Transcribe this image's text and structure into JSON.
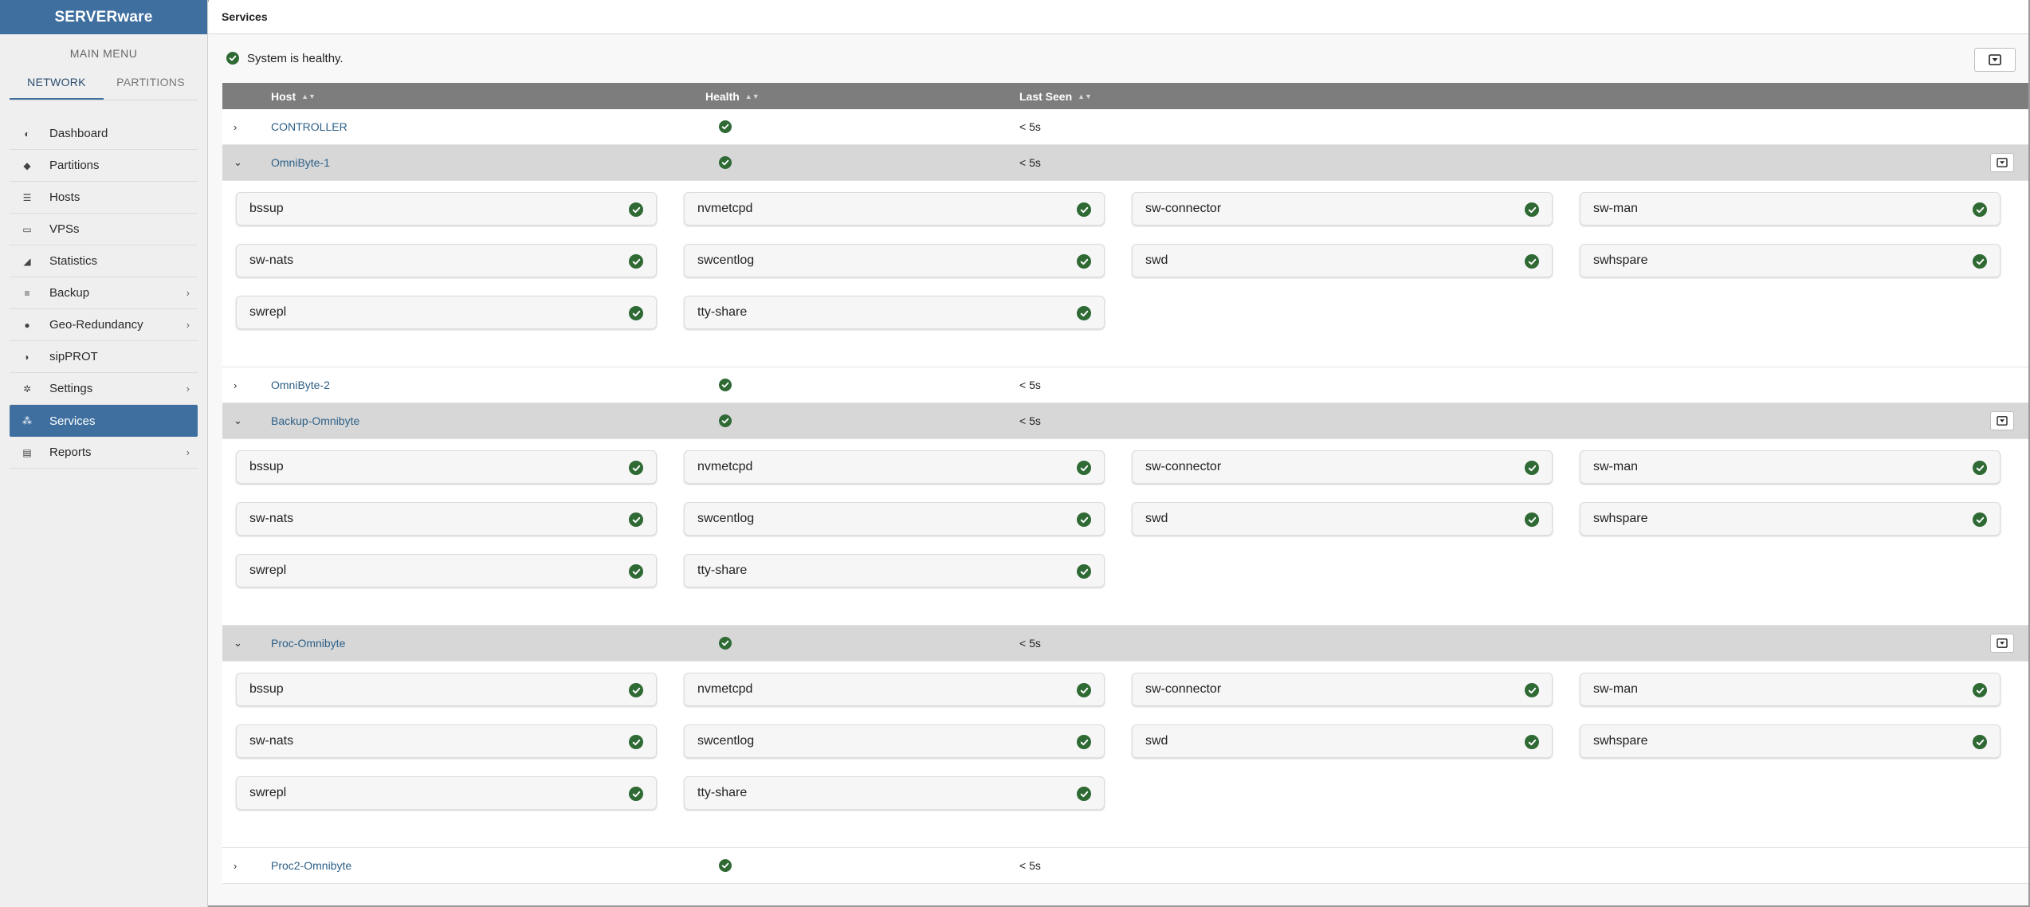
{
  "brand": "SERVERware",
  "menu": {
    "title": "MAIN MENU",
    "tabs": [
      {
        "label": "NETWORK",
        "active": true
      },
      {
        "label": "PARTITIONS",
        "active": false
      }
    ],
    "items": [
      {
        "label": "Dashboard",
        "icon": "dashboard-icon",
        "glyph": "◐",
        "submenu": false,
        "active": false
      },
      {
        "label": "Partitions",
        "icon": "cube-icon",
        "glyph": "◆",
        "submenu": false,
        "active": false
      },
      {
        "label": "Hosts",
        "icon": "list-icon",
        "glyph": "☰",
        "submenu": false,
        "active": false
      },
      {
        "label": "VPSs",
        "icon": "laptop-icon",
        "glyph": "▭",
        "submenu": false,
        "active": false
      },
      {
        "label": "Statistics",
        "icon": "area-chart-icon",
        "glyph": "◢",
        "submenu": false,
        "active": false
      },
      {
        "label": "Backup",
        "icon": "database-icon",
        "glyph": "≡",
        "submenu": true,
        "active": false
      },
      {
        "label": "Geo-Redundancy",
        "icon": "globe-icon",
        "glyph": "●",
        "submenu": true,
        "active": false
      },
      {
        "label": "sipPROT",
        "icon": "shield-icon",
        "glyph": "◗",
        "submenu": false,
        "active": false
      },
      {
        "label": "Settings",
        "icon": "cogs-icon",
        "glyph": "✲",
        "submenu": true,
        "active": false
      },
      {
        "label": "Services",
        "icon": "network-icon",
        "glyph": "⁂",
        "submenu": false,
        "active": true
      },
      {
        "label": "Reports",
        "icon": "file-icon",
        "glyph": "▤",
        "submenu": true,
        "active": false
      }
    ]
  },
  "page": {
    "title": "Services",
    "status": "System is healthy."
  },
  "table": {
    "columns": [
      "Host",
      "Health",
      "Last Seen"
    ],
    "rows": [
      {
        "host": "CONTROLLER",
        "last_seen": "< 5s",
        "expanded": false,
        "services": []
      },
      {
        "host": "OmniByte-1",
        "last_seen": "< 5s",
        "expanded": true,
        "services": [
          "bssup",
          "nvmetcpd",
          "sw-connector",
          "sw-man",
          "sw-nats",
          "swcentlog",
          "swd",
          "swhspare",
          "swrepl",
          "tty-share"
        ]
      },
      {
        "host": "OmniByte-2",
        "last_seen": "< 5s",
        "expanded": false,
        "services": []
      },
      {
        "host": "Backup-Omnibyte",
        "last_seen": "< 5s",
        "expanded": true,
        "services": [
          "bssup",
          "nvmetcpd",
          "sw-connector",
          "sw-man",
          "sw-nats",
          "swcentlog",
          "swd",
          "swhspare",
          "swrepl",
          "tty-share"
        ]
      },
      {
        "host": "Proc-Omnibyte",
        "last_seen": "< 5s",
        "expanded": true,
        "services": [
          "bssup",
          "nvmetcpd",
          "sw-connector",
          "sw-man",
          "sw-nats",
          "swcentlog",
          "swd",
          "swhspare",
          "swrepl",
          "tty-share"
        ]
      },
      {
        "host": "Proc2-Omnibyte",
        "last_seen": "< 5s",
        "expanded": false,
        "services": []
      }
    ]
  },
  "colors": {
    "brand": "#3f6f9f",
    "ok": "#2f6a35",
    "link": "#2c5f87",
    "header": "#7d7d7d",
    "expanded_row": "#d7d7d7"
  }
}
